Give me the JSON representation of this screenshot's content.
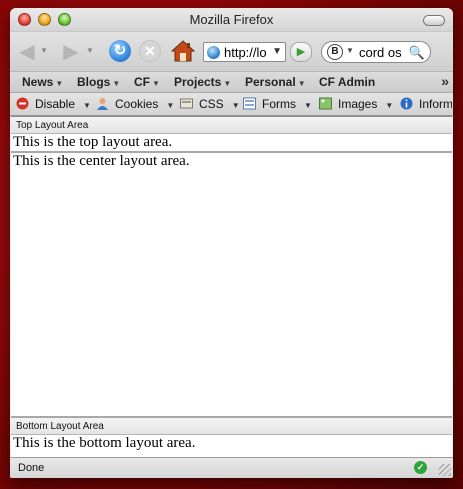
{
  "window": {
    "title": "Mozilla Firefox"
  },
  "navbar": {
    "url": "http://localhost/",
    "search": {
      "engine_letter": "B",
      "text": "cord os"
    },
    "icons": {
      "back": "back-arrow-icon",
      "forward": "forward-arrow-icon",
      "reload": "reload-icon",
      "stop": "stop-icon",
      "home": "home-icon",
      "go": "go-icon"
    }
  },
  "bookmarks": {
    "items": [
      {
        "label": "News"
      },
      {
        "label": "Blogs"
      },
      {
        "label": "CF"
      },
      {
        "label": "Projects"
      },
      {
        "label": "Personal"
      },
      {
        "label": "CF Admin"
      }
    ]
  },
  "devbar": {
    "items": [
      {
        "label": "Disable",
        "icon": "disable-icon"
      },
      {
        "label": "Cookies",
        "icon": "cookies-icon"
      },
      {
        "label": "CSS",
        "icon": "css-icon"
      },
      {
        "label": "Forms",
        "icon": "forms-icon"
      },
      {
        "label": "Images",
        "icon": "images-icon"
      },
      {
        "label": "Information",
        "icon": "information-icon"
      }
    ]
  },
  "page": {
    "top": {
      "header": "Top Layout Area",
      "text": "This is the top layout area."
    },
    "center": {
      "text": "This is the center layout area."
    },
    "bottom": {
      "header": "Bottom Layout Area",
      "text": "This is the bottom layout area."
    }
  },
  "status": {
    "text": "Done"
  },
  "colors": {
    "desktop": "#8a0606",
    "reload_blue": "#2a7fd8",
    "go_green": "#3aa22e",
    "status_ok_green": "#2ea43a"
  }
}
